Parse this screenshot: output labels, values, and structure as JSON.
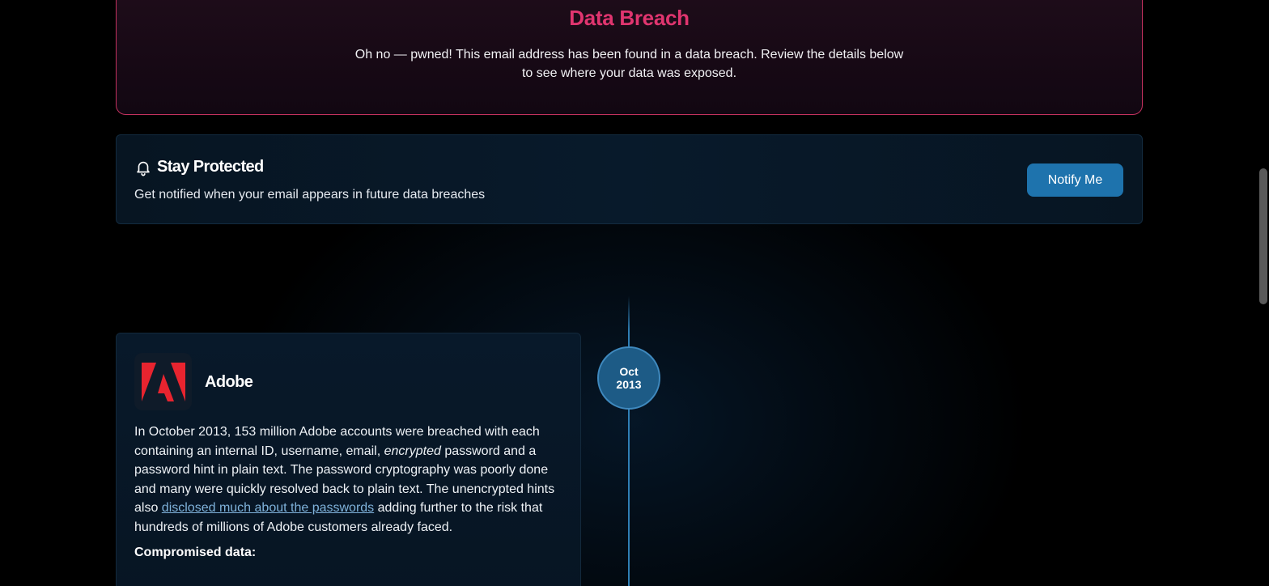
{
  "breach_banner": {
    "title": "Data Breach",
    "description": "Oh no — pwned! This email address has been found in a data breach. Review the details below to see where your data was exposed."
  },
  "protect": {
    "icon": "bell-icon",
    "title": "Stay Protected",
    "subtitle": "Get notified when your email appears in future data breaches",
    "button_label": "Notify Me"
  },
  "timeline": {
    "month": "Oct",
    "year": "2013"
  },
  "breach": {
    "name": "Adobe",
    "logo": "adobe-logo",
    "text_part1": "In October 2013, 153 million Adobe accounts were breached with each containing an internal ID, username, email, ",
    "text_emphasis": "encrypted",
    "text_part2": " password and a password hint in plain text. The password cryptography was poorly done and many were quickly resolved back to plain text. The unencrypted hints also ",
    "link_text": "disclosed much about the passwords",
    "text_part3": " adding further to the risk that hundreds of millions of Adobe customers already faced.",
    "compromised_label": "Compromised data:"
  },
  "colors": {
    "accent_pink": "#e0356f",
    "button_blue": "#1e73ad",
    "link_blue": "#7fb2db"
  }
}
